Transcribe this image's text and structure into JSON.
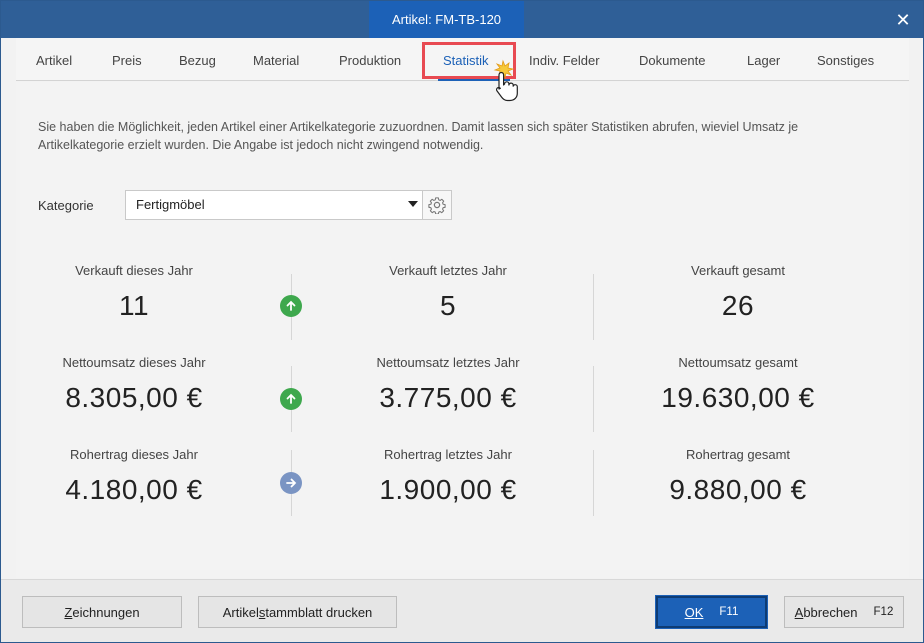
{
  "window": {
    "title": "Artikel: FM-TB-120",
    "close_glyph": "✕"
  },
  "tabs": [
    {
      "label": "Artikel"
    },
    {
      "label": "Preis"
    },
    {
      "label": "Bezug"
    },
    {
      "label": "Material"
    },
    {
      "label": "Produktion"
    },
    {
      "label": "Statistik"
    },
    {
      "label": "Indiv. Felder"
    },
    {
      "label": "Dokumente"
    },
    {
      "label": "Lager"
    },
    {
      "label": "Sonstiges"
    }
  ],
  "active_tab": "Statistik",
  "info_text": "Sie haben die Möglichkeit, jeden Artikel einer Artikelkategorie zuzuordnen. Damit lassen sich später Statistiken abrufen, wieviel Umsatz je Artikelkategorie erzielt wurden. Die Angabe ist jedoch nicht zwingend notwendig.",
  "kategorie": {
    "label": "Kategorie",
    "value": "Fertigmöbel"
  },
  "stats": {
    "verkauft": {
      "this_year": {
        "label": "Verkauft dieses Jahr",
        "value": "11"
      },
      "last_year": {
        "label": "Verkauft letztes Jahr",
        "value": "5"
      },
      "total": {
        "label": "Verkauft gesamt",
        "value": "26"
      },
      "trend": "up"
    },
    "nettoumsatz": {
      "this_year": {
        "label": "Nettoumsatz dieses Jahr",
        "value": "8.305,00 €"
      },
      "last_year": {
        "label": "Nettoumsatz letztes Jahr",
        "value": "3.775,00 €"
      },
      "total": {
        "label": "Nettoumsatz gesamt",
        "value": "19.630,00 €"
      },
      "trend": "up"
    },
    "rohertrag": {
      "this_year": {
        "label": "Rohertrag dieses Jahr",
        "value": "4.180,00 €"
      },
      "last_year": {
        "label": "Rohertrag letztes Jahr",
        "value": "1.900,00 €"
      },
      "total": {
        "label": "Rohertrag gesamt",
        "value": "9.880,00 €"
      },
      "trend": "equal"
    }
  },
  "footer": {
    "zeichnungen": {
      "pre": "",
      "u": "Z",
      "post": "eichnungen"
    },
    "stammblatt": {
      "pre": "Artikel",
      "u": "s",
      "post": "tammblatt drucken"
    },
    "ok": {
      "u": "O",
      "post": "K",
      "key": "F11"
    },
    "abbrechen": {
      "u": "A",
      "post": "bbrechen",
      "key": "F12"
    }
  },
  "colors": {
    "accent": "#1c61b7",
    "titlebar": "#2f5f97",
    "trend_up": "#3ea84d",
    "trend_equal": "#7a94c3",
    "highlight": "#e84a52"
  }
}
